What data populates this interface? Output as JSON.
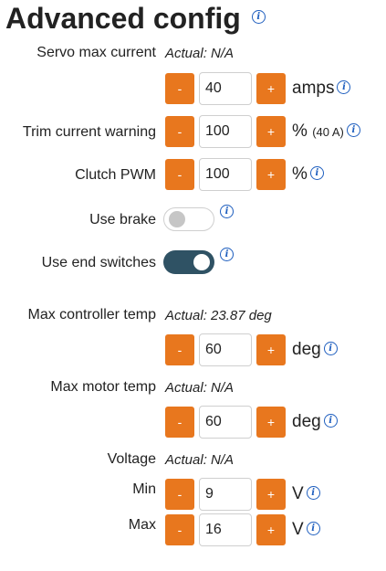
{
  "title": "Advanced config",
  "info_icon": "info-icon",
  "colors": {
    "accent": "#e8771e",
    "toggle_on": "#2f5264",
    "info": "#1f5fbf"
  },
  "servo_max_current": {
    "label": "Servo max current",
    "actual": "Actual: N/A",
    "value": "40",
    "unit": "amps",
    "minus": "-",
    "plus": "+"
  },
  "trim_current_warning": {
    "label": "Trim current warning",
    "value": "100",
    "unit": "%",
    "note": "(40 A)",
    "minus": "-",
    "plus": "+"
  },
  "clutch_pwm": {
    "label": "Clutch PWM",
    "value": "100",
    "unit": "%",
    "minus": "-",
    "plus": "+"
  },
  "use_brake": {
    "label": "Use brake",
    "enabled": false
  },
  "use_end_switches": {
    "label": "Use end switches",
    "enabled": true
  },
  "max_controller_temp": {
    "label": "Max controller temp",
    "actual": "Actual: 23.87 deg",
    "value": "60",
    "unit": "deg",
    "minus": "-",
    "plus": "+"
  },
  "max_motor_temp": {
    "label": "Max motor temp",
    "actual": "Actual: N/A",
    "value": "60",
    "unit": "deg",
    "minus": "-",
    "plus": "+"
  },
  "voltage": {
    "label": "Voltage",
    "actual": "Actual: N/A",
    "min": {
      "label": "Min",
      "value": "9",
      "unit": "V",
      "minus": "-",
      "plus": "+"
    },
    "max": {
      "label": "Max",
      "value": "16",
      "unit": "V",
      "minus": "-",
      "plus": "+"
    }
  }
}
